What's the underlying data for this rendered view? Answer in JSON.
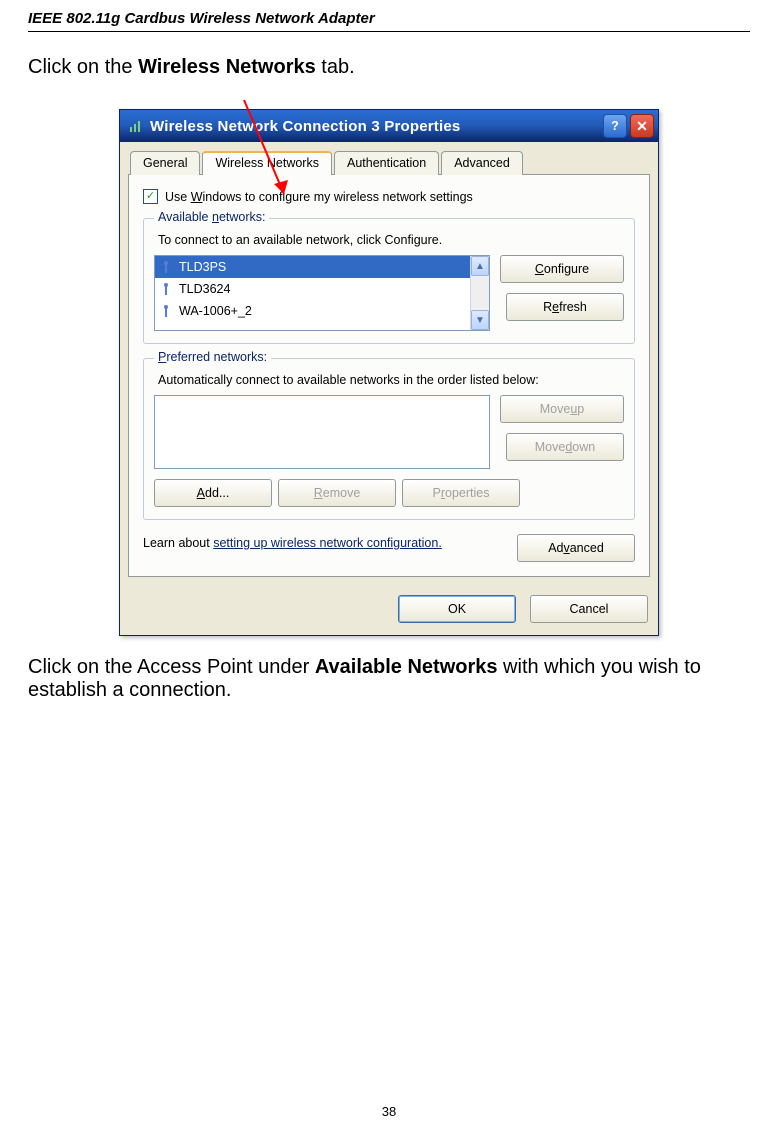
{
  "doc": {
    "header": "IEEE 802.11g Cardbus Wireless Network Adapter",
    "instruction1_prefix": "Click on the ",
    "instruction1_bold": "Wireless Networks",
    "instruction1_suffix": " tab.",
    "instruction2_prefix": "Click on the Access Point under ",
    "instruction2_bold": "Available Networks",
    "instruction2_suffix": " with which you wish to establish a connection.",
    "page_number": "38"
  },
  "dialog": {
    "title": "Wireless Network Connection 3 Properties",
    "tabs": {
      "t0": "General",
      "t1": "Wireless Networks",
      "t2": "Authentication",
      "t3": "Advanced"
    },
    "checkbox_label_pre": "Use ",
    "checkbox_label_u": "W",
    "checkbox_label_post": "indows to configure my wireless network settings",
    "checkbox_checked": "✓",
    "avail": {
      "legend_pre": "Available ",
      "legend_u": "n",
      "legend_post": "etworks:",
      "help": "To connect to an available network, click Configure.",
      "items": {
        "i0": "TLD3PS",
        "i1": "TLD3624",
        "i2": "WA-1006+_2"
      },
      "btn_configure_u": "C",
      "btn_configure_rest": "onfigure",
      "btn_refresh_pre": "R",
      "btn_refresh_u": "e",
      "btn_refresh_post": "fresh"
    },
    "pref": {
      "legend_u": "P",
      "legend_post": "referred networks:",
      "help": "Automatically connect to available networks in the order listed below:",
      "btn_moveup_pre": "Move ",
      "btn_moveup_u": "u",
      "btn_moveup_post": "p",
      "btn_movedown_pre": "Move ",
      "btn_movedown_u": "d",
      "btn_movedown_post": "own",
      "btn_add_u": "A",
      "btn_add_post": "dd...",
      "btn_remove_u": "R",
      "btn_remove_post": "emove",
      "btn_props_pre": "P",
      "btn_props_u": "r",
      "btn_props_post": "operties"
    },
    "learn_pre": "Learn about ",
    "learn_link": "setting up wireless network configuration.",
    "btn_adv_pre": "Ad",
    "btn_adv_u": "v",
    "btn_adv_post": "anced",
    "btn_ok": "OK",
    "btn_cancel": "Cancel"
  }
}
